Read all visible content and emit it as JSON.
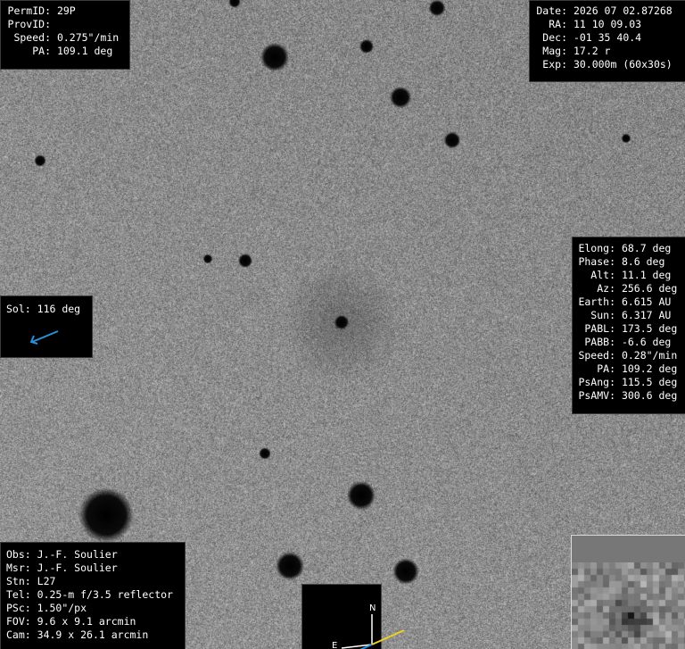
{
  "target": {
    "perm_id_label": "PermID:",
    "perm_id": "29P",
    "prov_id_label": "ProvID:",
    "prov_id": "",
    "speed_label": "Speed:",
    "speed": "0.275\"/min",
    "pa_label": "PA:",
    "pa": "109.1 deg"
  },
  "observation": {
    "date_label": "Date:",
    "date": "2026 07 02.87268",
    "ra_label": "RA:",
    "ra": "11 10 09.03",
    "dec_label": "Dec:",
    "dec": "-01 35 40.4",
    "mag_label": "Mag:",
    "mag": "17.2 r",
    "exp_label": "Exp:",
    "exp": "30.000m (60x30s)"
  },
  "geometry": {
    "elong_label": "Elong:",
    "elong": "68.7 deg",
    "phase_label": "Phase:",
    "phase": "8.6 deg",
    "alt_label": "Alt:",
    "alt": "11.1 deg",
    "az_label": "Az:",
    "az": "256.6 deg",
    "earth_label": "Earth:",
    "earth": "6.615 AU",
    "sun_label": "Sun:",
    "sun": "6.317 AU",
    "pabl_label": "PABL:",
    "pabl": "173.5 deg",
    "pabb_label": "PABB:",
    "pabb": "-6.6 deg",
    "speed_label": "Speed:",
    "speed": "0.28\"/min",
    "pa_label": "PA:",
    "pa": "109.2 deg",
    "psang_label": "PsAng:",
    "psang": "115.5 deg",
    "psamv_label": "PsAMV:",
    "psamv": "300.6 deg"
  },
  "sol": {
    "label": "Sol:",
    "value": "116 deg",
    "arrow_color": "#2a8fd6"
  },
  "equipment": {
    "obs_label": "Obs:",
    "obs": "J.-F. Soulier",
    "msr_label": "Msr:",
    "msr": "J.-F. Soulier",
    "stn_label": "Stn:",
    "stn": "L27",
    "tel_label": "Tel:",
    "tel": "0.25-m f/3.5 reflector",
    "psc_label": "PSc:",
    "psc": "1.50\"/px",
    "fov_label": "FOV:",
    "fov": "9.6 x 9.1 arcmin",
    "cam_label": "Cam:",
    "cam": "34.9 x 26.1 arcmin"
  },
  "compass": {
    "north_label": "N",
    "east_label": "E",
    "axis_color": "#ffffff",
    "motion_color": "#f0d020",
    "sun_color": "#2a8fd6"
  }
}
